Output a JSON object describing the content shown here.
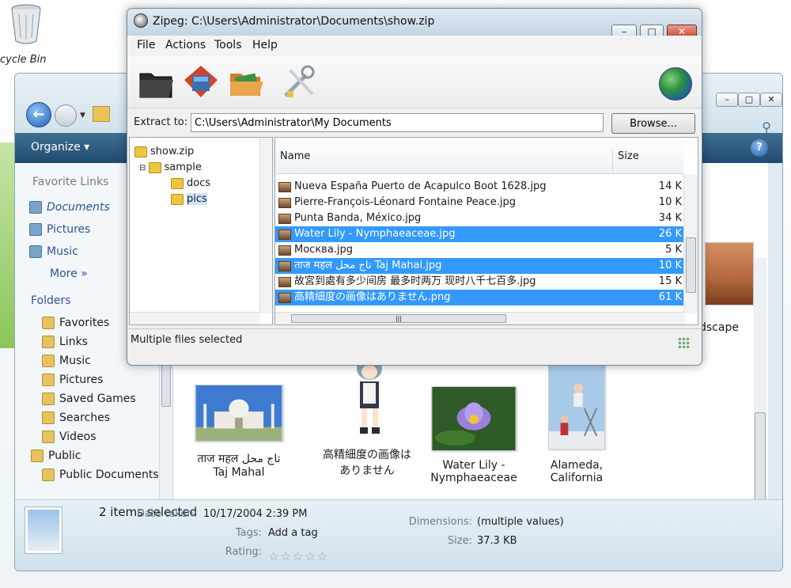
{
  "desktop": {
    "recycle_bin_label": "cycle Bin"
  },
  "explorer": {
    "toolbar": {
      "organize_label": "Organize ▾"
    },
    "favorites": {
      "title": "Favorite Links",
      "items": [
        "Documents",
        "Pictures",
        "Music"
      ],
      "more_label": "More  »"
    },
    "folders": {
      "title": "Folders",
      "items": [
        "Favorites",
        "Links",
        "Music",
        "Pictures",
        "Saved Games",
        "Searches",
        "Videos",
        "Public",
        "Public Documents"
      ]
    },
    "thumbnails": [
      {
        "label": "ताज महल تاج محل\nTaj Mahal"
      },
      {
        "label": "高精細度の画像は\nありません"
      },
      {
        "label": "Water Lily -\nNymphaeaceae"
      },
      {
        "label": "Alameda,\nCalifornia"
      }
    ],
    "landscape_label": "dscape",
    "details": {
      "selected_count": "2 items selected",
      "date_taken_label": "Date taken:",
      "date_taken_value": "10/17/2004 2:39 PM",
      "tags_label": "Tags:",
      "tags_value": "Add a tag",
      "rating_label": "Rating:",
      "rating_stars": "☆☆☆☆☆",
      "dimensions_label": "Dimensions:",
      "dimensions_value": "(multiple values)",
      "size_label": "Size:",
      "size_value": "37.3 KB"
    }
  },
  "zipeg": {
    "title": "Zipeg: C:\\Users\\Administrator\\Documents\\show.zip",
    "menu": [
      "File",
      "Actions",
      "Tools",
      "Help"
    ],
    "extract_label": "Extract to:",
    "extract_value": "C:\\Users\\Administrator\\My Documents",
    "browse_label": "Browse...",
    "tree": [
      {
        "label": "show.zip",
        "level": 0
      },
      {
        "label": "sample",
        "level": 1
      },
      {
        "label": "docs",
        "level": 2
      },
      {
        "label": "pics",
        "level": 2,
        "selected": true
      }
    ],
    "columns": {
      "name": "Name",
      "size": "Size"
    },
    "files": [
      {
        "name": "Nueva España Puerto de Acapulco Boot 1628.jpg",
        "size": "14 K",
        "selected": false
      },
      {
        "name": "Pierre-François-Léonard Fontaine Peace.jpg",
        "size": "10 K",
        "selected": false
      },
      {
        "name": "Punta Banda, México.jpg",
        "size": "34 K",
        "selected": false
      },
      {
        "name": "Water Lily - Nymphaeaceae.jpg",
        "size": "26 K",
        "selected": true
      },
      {
        "name": "Москва.jpg",
        "size": "5 K",
        "selected": false
      },
      {
        "name": "ताज महल تاج محل Taj Mahal.jpg",
        "size": "10 K",
        "selected": true
      },
      {
        "name": "故宮到處有多少间房 最多时两万 现时八千七百多.jpg",
        "size": "15 K",
        "selected": false
      },
      {
        "name": "高精細度の画像はありません.png",
        "size": "61 K",
        "selected": true
      }
    ],
    "status": "Multiple files selected",
    "accent_selection": "#3399ff"
  }
}
